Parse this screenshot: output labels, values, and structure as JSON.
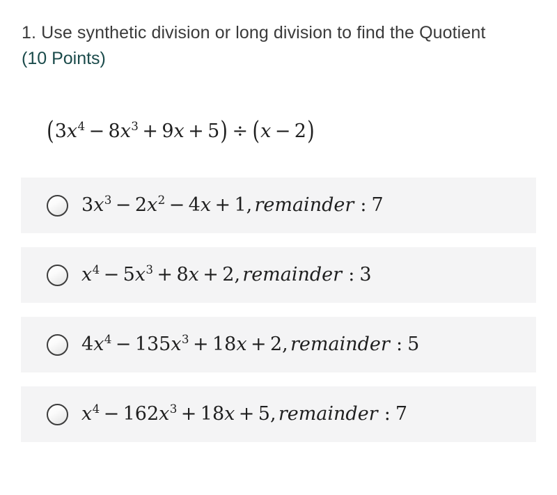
{
  "question": {
    "prompt": "1. Use synthetic division or long division to find the Quotient",
    "points_label": "(10 Points)",
    "points_color": "#1b4b4b"
  },
  "expression": {
    "plain": "(3x^4 - 8x^3 + 9x + 5) ÷ (x - 2)",
    "open_paren": "(",
    "t1_coef": "3",
    "t1_var": "x",
    "t1_exp": "4",
    "op1": "−",
    "t2_coef": "8",
    "t2_var": "x",
    "t2_exp": "3",
    "op2": "+",
    "t3_coef": "9",
    "t3_var": "x",
    "op3": "+",
    "t4_const": "5",
    "close_paren": ")",
    "divide_op": "÷",
    "d_open_paren": "(",
    "d_var": "x",
    "d_op": "−",
    "d_const": "2",
    "d_close_paren": ")"
  },
  "options": [
    {
      "id": "option-a",
      "plain": "3x^3 - 2x^2 - 4x + 1, remainder : 7",
      "c1": "3",
      "v1": "x",
      "e1": "3",
      "o1": "−",
      "c2": "2",
      "v2": "x",
      "e2": "2",
      "o2": "−",
      "c3": "4",
      "v3": "x",
      "o3": "+",
      "const": "1",
      "comma": ",",
      "remainder_word": "remainder",
      "colon": ":",
      "remainder_value": "7",
      "selected": false
    },
    {
      "id": "option-b",
      "plain": "x^4 - 5x^3 + 8x + 2, remainder : 3",
      "c1": "",
      "v1": "x",
      "e1": "4",
      "o1": "−",
      "c2": "5",
      "v2": "x",
      "e2": "3",
      "o2": "+",
      "c3": "8",
      "v3": "x",
      "o3": "+",
      "const": "2",
      "comma": ",",
      "remainder_word": "remainder",
      "colon": ":",
      "remainder_value": "3",
      "selected": false
    },
    {
      "id": "option-c",
      "plain": "4x^4 - 135x^3 + 18x + 2, remainder : 5",
      "c1": "4",
      "v1": "x",
      "e1": "4",
      "o1": "−",
      "c2": "135",
      "v2": "x",
      "e2": "3",
      "o2": "+",
      "c3": "18",
      "v3": "x",
      "o3": "+",
      "const": "2",
      "comma": ",",
      "remainder_word": "remainder",
      "colon": ":",
      "remainder_value": "5",
      "selected": false
    },
    {
      "id": "option-d",
      "plain": "x^4 - 162x^3 + 18x + 5, remainder : 7",
      "c1": "",
      "v1": "x",
      "e1": "4",
      "o1": "−",
      "c2": "162",
      "v2": "x",
      "e2": "3",
      "o2": "+",
      "c3": "18",
      "v3": "x",
      "o3": "+",
      "const": "5",
      "comma": ",",
      "remainder_word": "remainder",
      "colon": ":",
      "remainder_value": "7",
      "selected": false
    }
  ],
  "colors": {
    "page_background": "#ffffff",
    "option_background": "#f4f4f5",
    "text": "#3a3a3a",
    "math_text": "#1f1f1f",
    "radio_border": "#3c3c3c"
  }
}
